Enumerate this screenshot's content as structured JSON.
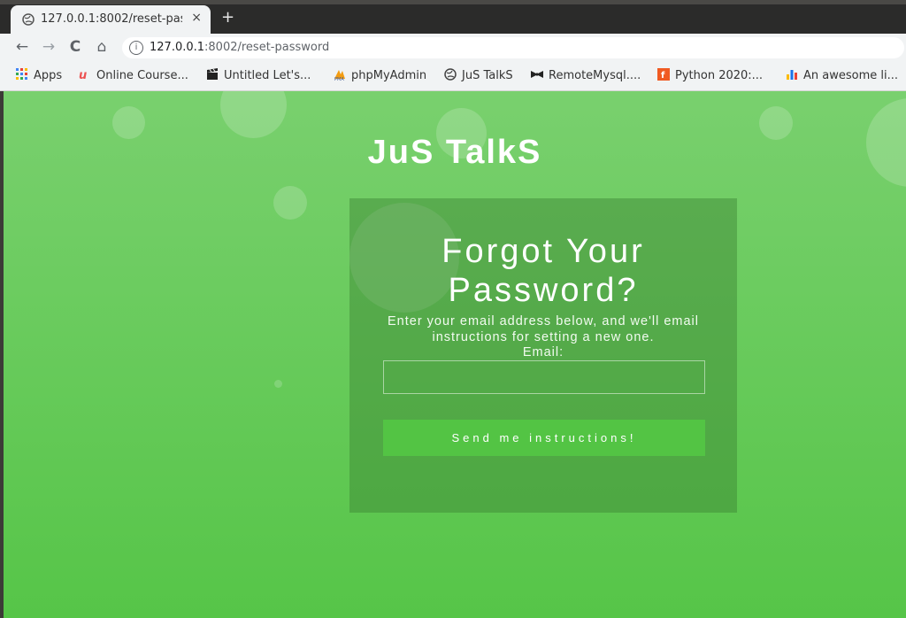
{
  "browser": {
    "tab_title": "127.0.0.1:8002/reset-pass",
    "tab_close": "×",
    "new_tab": "+",
    "url_host": "127.0.0.1",
    "url_path": ":8002/reset-password",
    "nav_back": "←",
    "nav_forward": "→",
    "nav_reload": "C",
    "nav_home": "⌂",
    "info_icon": "i"
  },
  "bookmarks": [
    {
      "label": "Apps",
      "icon": "apps-grid-icon",
      "color": "#4285f4"
    },
    {
      "label": "Online Course...",
      "icon": "udemy-icon",
      "color": "#ec5252"
    },
    {
      "label": "Untitled Let's...",
      "icon": "clapperboard-icon",
      "color": "#222222"
    },
    {
      "label": "phpMyAdmin",
      "icon": "phpmyadmin-icon",
      "color": "#f39c12"
    },
    {
      "label": "JuS TalkS",
      "icon": "globe-icon",
      "color": "#444444"
    },
    {
      "label": "RemoteMysql....",
      "icon": "bowtie-icon",
      "color": "#222222"
    },
    {
      "label": "Python 2020:...",
      "icon": "python-course-icon",
      "color": "#f05a22"
    },
    {
      "label": "An awesome li...",
      "icon": "bar-chart-icon",
      "color": "#1a73e8"
    }
  ],
  "page": {
    "brand": "JuS TalkS",
    "heading": "Forgot Your Password?",
    "description": "Enter your email address below, and we'll email instructions for setting a new one.",
    "email_label": "Email:",
    "email_value": "",
    "submit_label": "Send me instructions!",
    "colors": {
      "background_top": "#79d06e",
      "background_bottom": "#56c548",
      "button": "#53c444"
    }
  }
}
